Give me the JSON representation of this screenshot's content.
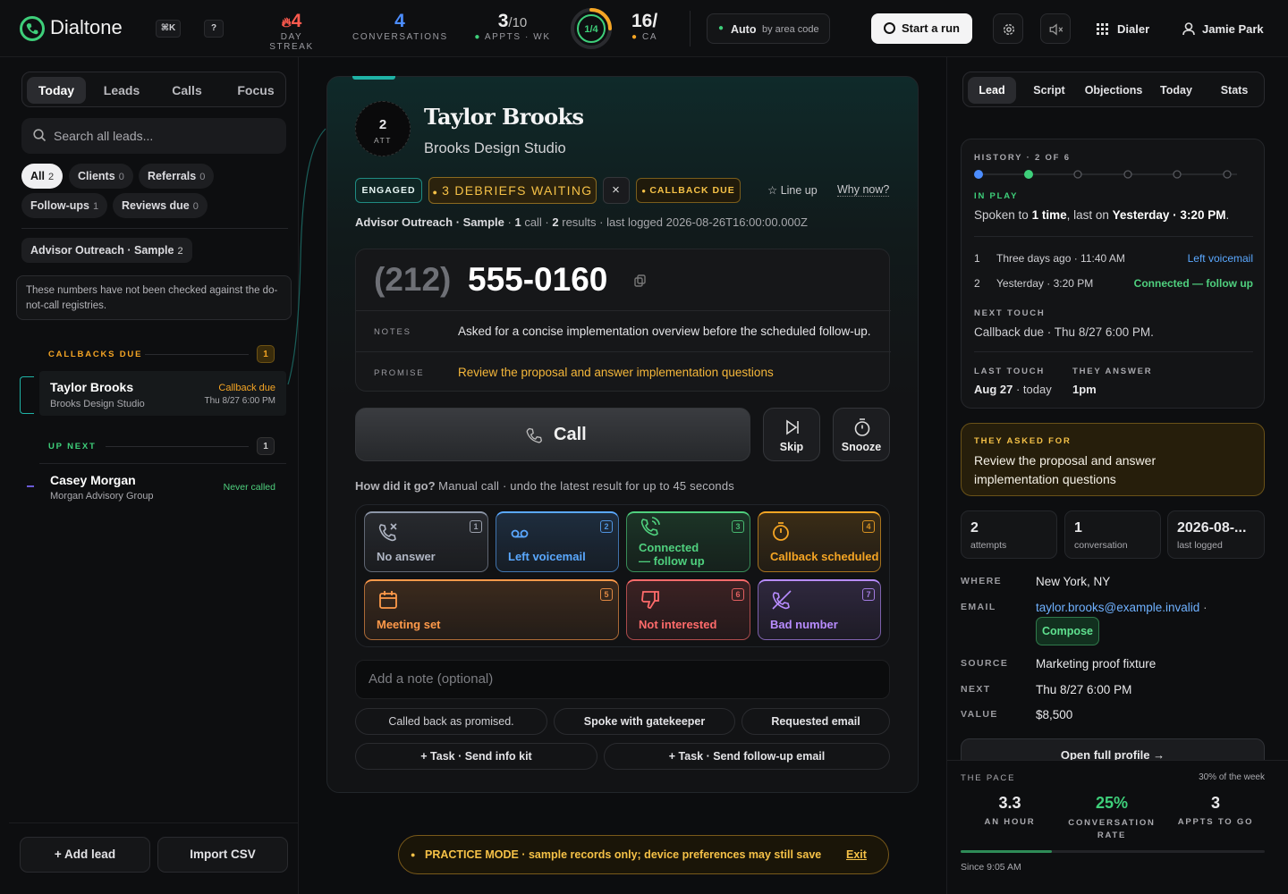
{
  "app": {
    "name": "Dialtone",
    "kbd_search": "⌘K",
    "kbd_help": "?"
  },
  "topbar": {
    "streak": {
      "value": "4",
      "label": "DAY STREAK"
    },
    "conversations": {
      "value": "4",
      "label": "CONVERSATIONS"
    },
    "appts": {
      "value": "3",
      "total": "/10",
      "label": "APPTS · WK"
    },
    "ring": {
      "text": "1/4",
      "progress": 0.25
    },
    "calls": {
      "value": "16/",
      "label": "CA"
    },
    "auto": {
      "label": "Auto",
      "sub": "by area code"
    },
    "start_run": "Start a run",
    "dialer": "Dialer",
    "user": "Jamie Park"
  },
  "left": {
    "tabs": [
      "Today",
      "Leads",
      "Calls",
      "Focus"
    ],
    "search_placeholder": "Search all leads...",
    "chips": [
      {
        "label": "All",
        "count": "2"
      },
      {
        "label": "Clients",
        "count": "0"
      },
      {
        "label": "Referrals",
        "count": "0"
      },
      {
        "label": "Follow-ups",
        "count": "1"
      },
      {
        "label": "Reviews due",
        "count": "0"
      }
    ],
    "campaign": {
      "label": "Advisor Outreach · Sample",
      "count": "2"
    },
    "notice": "These numbers have not been checked against the do-not-call registries.",
    "callbacks_due": {
      "label": "CALLBACKS DUE",
      "count": "1"
    },
    "up_next": {
      "label": "UP NEXT",
      "count": "1"
    },
    "leads": [
      {
        "name": "Taylor Brooks",
        "company": "Brooks Design Studio",
        "status": "Callback due",
        "time": "Thu 8/27 6:00 PM"
      },
      {
        "name": "Casey Morgan",
        "company": "Morgan Advisory Group",
        "status": "Never called"
      }
    ],
    "add_lead": "+ Add lead",
    "import_csv": "Import CSV"
  },
  "lead": {
    "attempts": "2",
    "att_label": "ATT",
    "name": "Taylor Brooks",
    "company": "Brooks Design Studio",
    "tags": {
      "engaged": "ENGAGED",
      "debriefs": "3 DEBRIEFS WAITING",
      "close": "×",
      "callback": "CALLBACK DUE",
      "line_up": "Line up",
      "why_now": "Why now?"
    },
    "meta": {
      "campaign": "Advisor Outreach · Sample",
      "calls": "1",
      "calls_word": "call ·",
      "results": "2",
      "results_word": "results",
      "last_logged": "· last logged 2026-08-26T16:00:00.000Z"
    },
    "phone_area": "(212)",
    "phone_number": "555-0160",
    "notes_label": "NOTES",
    "notes": "Asked for a concise implementation overview before the scheduled follow-up.",
    "promise_label": "PROMISE",
    "promise": "Review the proposal and answer implementation questions",
    "call": "Call",
    "skip": "Skip",
    "snooze": "Snooze",
    "how": "How did it go?",
    "how_sub": "Manual call · undo the latest result for up to 45 seconds",
    "outcomes": [
      {
        "n": "1",
        "label": "No answer",
        "color": "#8d96a8"
      },
      {
        "n": "2",
        "label": "Left voicemail",
        "color": "#5aa8ff"
      },
      {
        "n": "3",
        "label1": "Connected",
        "label2": "— follow up",
        "color": "#4fd07e"
      },
      {
        "n": "4",
        "label": "Callback scheduled",
        "color": "#f5a524"
      },
      {
        "n": "5",
        "label": "Meeting set",
        "color": "#ff9a4a"
      },
      {
        "n": "6",
        "label": "Not interested",
        "color": "#ff6b6b"
      },
      {
        "n": "7",
        "label": "Bad number",
        "color": "#b88cff"
      }
    ],
    "note_placeholder": "Add a note (optional)",
    "quick": [
      "Called back as promised.",
      "Spoke with gatekeeper",
      "Requested email"
    ],
    "tasks": [
      "+ Task · Send info kit",
      "+ Task · Send follow-up email"
    ]
  },
  "practice": {
    "text": "PRACTICE MODE · sample records only; device preferences may still save",
    "exit": "Exit"
  },
  "right": {
    "tabs": [
      "Lead",
      "Script",
      "Objections",
      "Today",
      "Stats"
    ],
    "history_label": "HISTORY · 2 OF 6",
    "in_play": "IN PLAY",
    "spoken_pre": "Spoken to",
    "spoken_times": "1 time",
    "spoken_mid": ", last on",
    "spoken_when": "Yesterday · 3:20 PM",
    "spoken_end": ".",
    "history": [
      {
        "n": "1",
        "when": "Three days ago · 11:40 AM",
        "result": "Left voicemail",
        "color": "#5aa8ff"
      },
      {
        "n": "2",
        "when": "Yesterday · 3:20 PM",
        "result": "Connected — follow up",
        "color": "#4fd07e"
      }
    ],
    "next_touch_label": "NEXT TOUCH",
    "next_touch": "Callback due · Thu 8/27 6:00 PM.",
    "last_touch_label": "LAST TOUCH",
    "last_touch": "Aug 27",
    "last_touch_sub": "· today",
    "they_answer_label": "THEY ANSWER",
    "they_answer": "1pm",
    "asked_label": "THEY ASKED FOR",
    "asked": "Review the proposal and answer implementation questions",
    "minis": [
      {
        "value": "2",
        "label": "attempts"
      },
      {
        "value": "1",
        "label": "conversation"
      },
      {
        "value": "2026-08-...",
        "label": "last logged"
      }
    ],
    "fields": {
      "where_k": "WHERE",
      "where": "New York, NY",
      "email_k": "EMAIL",
      "email": "taylor.brooks@example.invalid",
      "email_sep": "·",
      "compose": "Compose",
      "source_k": "SOURCE",
      "source": "Marketing proof fixture",
      "next_k": "NEXT",
      "next": "Thu 8/27 6:00 PM",
      "value_k": "VALUE",
      "value": "$8,500"
    },
    "open_profile": "Open full profile →",
    "pace": {
      "label": "THE PACE",
      "week": "30% of the week",
      "week_fraction": 0.3,
      "per_hour": "3.3",
      "per_hour_label": "AN HOUR",
      "conv_rate": "25%",
      "conv_rate_label": "CONVERSATION RATE",
      "appts": "3",
      "appts_label": "APPTS TO GO",
      "since": "Since 9:05 AM"
    }
  },
  "colors": {
    "accent": "#3ecf7a",
    "amber": "#f5c147",
    "teal": "#1fb3a6"
  }
}
